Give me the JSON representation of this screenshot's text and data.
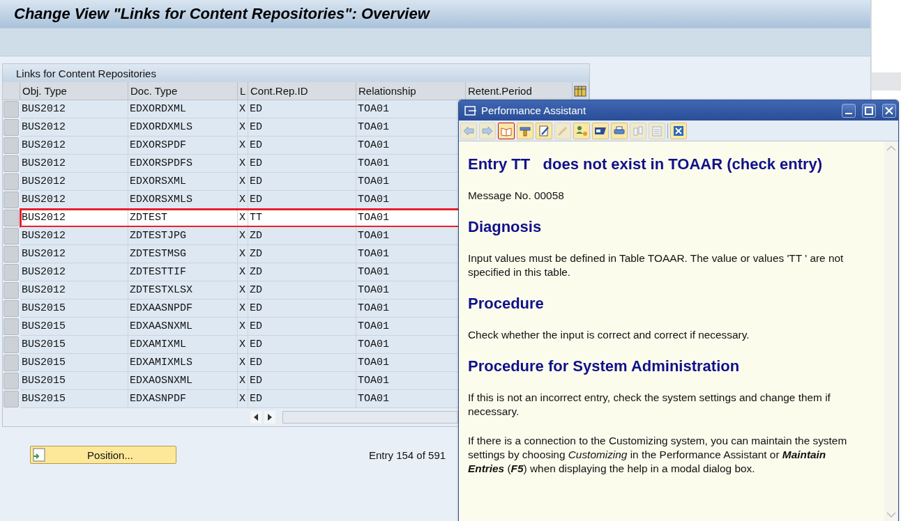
{
  "window": {
    "title": "Change View \"Links for Content Repositories\": Overview"
  },
  "table": {
    "title": "Links for Content Repositories",
    "columns": [
      "Obj. Type",
      "Doc. Type",
      "L",
      "Cont.Rep.ID",
      "Relationship",
      "Retent.Period"
    ],
    "rows": [
      {
        "cells": [
          "BUS2012",
          "EDXORDXML",
          "X",
          "ED",
          "TOA01"
        ],
        "selected": false
      },
      {
        "cells": [
          "BUS2012",
          "EDXORDXMLS",
          "X",
          "ED",
          "TOA01"
        ],
        "selected": false
      },
      {
        "cells": [
          "BUS2012",
          "EDXORSPDF",
          "X",
          "ED",
          "TOA01"
        ],
        "selected": false
      },
      {
        "cells": [
          "BUS2012",
          "EDXORSPDFS",
          "X",
          "ED",
          "TOA01"
        ],
        "selected": false
      },
      {
        "cells": [
          "BUS2012",
          "EDXORSXML",
          "X",
          "ED",
          "TOA01"
        ],
        "selected": false
      },
      {
        "cells": [
          "BUS2012",
          "EDXORSXMLS",
          "X",
          "ED",
          "TOA01"
        ],
        "selected": false
      },
      {
        "cells": [
          "BUS2012",
          "ZDTEST",
          "X",
          "TT",
          "TOA01"
        ],
        "selected": true
      },
      {
        "cells": [
          "BUS2012",
          "ZDTESTJPG",
          "X",
          "ZD",
          "TOA01"
        ],
        "selected": false
      },
      {
        "cells": [
          "BUS2012",
          "ZDTESTMSG",
          "X",
          "ZD",
          "TOA01"
        ],
        "selected": false
      },
      {
        "cells": [
          "BUS2012",
          "ZDTESTTIF",
          "X",
          "ZD",
          "TOA01"
        ],
        "selected": false
      },
      {
        "cells": [
          "BUS2012",
          "ZDTESTXLSX",
          "X",
          "ZD",
          "TOA01"
        ],
        "selected": false
      },
      {
        "cells": [
          "BUS2015",
          "EDXAASNPDF",
          "X",
          "ED",
          "TOA01"
        ],
        "selected": false
      },
      {
        "cells": [
          "BUS2015",
          "EDXAASNXML",
          "X",
          "ED",
          "TOA01"
        ],
        "selected": false
      },
      {
        "cells": [
          "BUS2015",
          "EDXAMIXML",
          "X",
          "ED",
          "TOA01"
        ],
        "selected": false
      },
      {
        "cells": [
          "BUS2015",
          "EDXAMIXMLS",
          "X",
          "ED",
          "TOA01"
        ],
        "selected": false
      },
      {
        "cells": [
          "BUS2015",
          "EDXAOSNXML",
          "X",
          "ED",
          "TOA01"
        ],
        "selected": false
      },
      {
        "cells": [
          "BUS2015",
          "EDXASNPDF",
          "X",
          "ED",
          "TOA01"
        ],
        "selected": false
      }
    ]
  },
  "position_button": {
    "label": "Position..."
  },
  "entry_info": "Entry 154 of 591",
  "assistant": {
    "title": "Performance Assistant",
    "toolbar": [
      {
        "kind": "back",
        "disabled": true,
        "selected": false
      },
      {
        "kind": "forward",
        "disabled": true,
        "selected": false
      },
      {
        "kind": "book",
        "disabled": false,
        "selected": true
      },
      {
        "kind": "tools",
        "disabled": false,
        "selected": false
      },
      {
        "kind": "edit",
        "disabled": false,
        "selected": false
      },
      {
        "kind": "pencil",
        "disabled": true,
        "selected": false
      },
      {
        "kind": "userkey",
        "disabled": false,
        "selected": false
      },
      {
        "kind": "label",
        "disabled": false,
        "selected": false
      },
      {
        "kind": "print",
        "disabled": false,
        "selected": false
      },
      {
        "kind": "binoculars",
        "disabled": true,
        "selected": false
      },
      {
        "kind": "list",
        "disabled": true,
        "selected": false
      },
      {
        "kind": "close",
        "disabled": false,
        "selected": false
      }
    ],
    "content": [
      {
        "kind": "title",
        "text": "Entry TT   does not exist in TOAAR (check entry)"
      },
      {
        "kind": "text",
        "text": "Message No. 00058"
      },
      {
        "kind": "heading",
        "text": "Diagnosis"
      },
      {
        "kind": "text",
        "text": "Input values must be defined in Table TOAAR. The value or values 'TT  ' are not specified in this table."
      },
      {
        "kind": "heading",
        "text": "Procedure"
      },
      {
        "kind": "text",
        "text": "Check whether the input is correct and correct if necessary."
      },
      {
        "kind": "heading",
        "text": "Procedure for System Administration"
      },
      {
        "kind": "text",
        "text": "If this is not an incorrect entry, check the system settings and change them if necessary."
      },
      {
        "kind": "text",
        "text": "If there is a connection to the Customizing system, you can maintain the system settings by choosing *Customizing* in the Performance Assistant or **Maintain Entries** (**F5**) when displaying the help in a modal dialog box."
      }
    ]
  }
}
